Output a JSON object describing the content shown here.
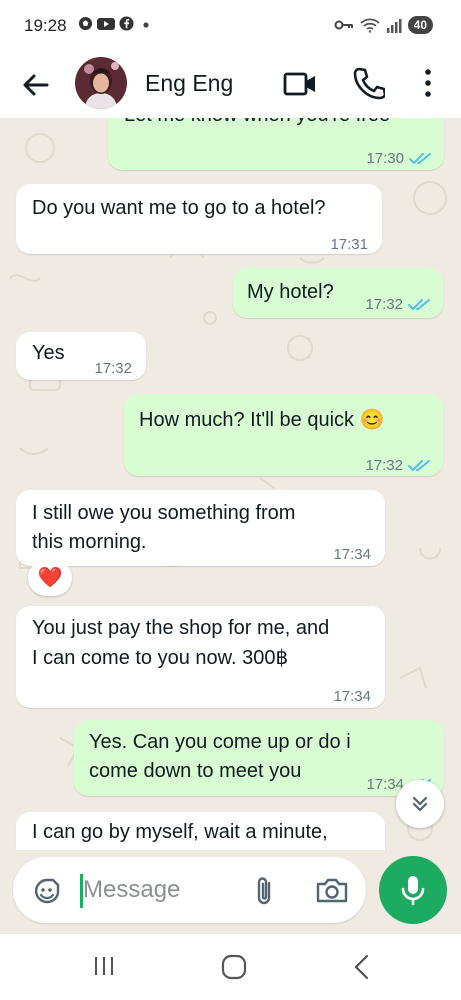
{
  "status_bar": {
    "time": "19:28",
    "notification_icons": [
      "football-icon",
      "youtube-icon",
      "facebook-icon",
      "dot-icon"
    ],
    "system_icons": [
      "key-icon",
      "wifi-icon",
      "signal-icon"
    ],
    "battery": "40"
  },
  "header": {
    "contact_name": "Eng Eng"
  },
  "messages": [
    {
      "direction": "out",
      "text": "Let me know when you're free",
      "time": "17:30",
      "status": "read"
    },
    {
      "direction": "in",
      "text": "Do you want me to go to a hotel?",
      "time": "17:31"
    },
    {
      "direction": "out",
      "text": "My hotel?",
      "time": "17:32",
      "status": "read"
    },
    {
      "direction": "in",
      "text": "Yes",
      "time": "17:32"
    },
    {
      "direction": "out",
      "text": "How much? It'll be quick 😊",
      "time": "17:32",
      "status": "read"
    },
    {
      "direction": "in",
      "lines": [
        "I still owe you something from",
        "this morning."
      ],
      "time": "17:34",
      "reaction": "❤️"
    },
    {
      "direction": "in",
      "lines": [
        "You just pay the shop for me, and",
        "I can come to you now. 300฿"
      ],
      "time": "17:34"
    },
    {
      "direction": "out",
      "lines": [
        "Yes. Can you come up or do i",
        "come down to meet you"
      ],
      "time": "17:34",
      "status": "read"
    },
    {
      "direction": "in",
      "text": "I can go by myself, wait a minute,"
    }
  ],
  "composer": {
    "placeholder": "Message"
  },
  "colors": {
    "accent_green": "#1daa61",
    "outgoing_bubble": "#d9fdd3",
    "incoming_bubble": "#ffffff",
    "chat_background": "#efeae2",
    "read_ticks": "#53bdeb"
  }
}
